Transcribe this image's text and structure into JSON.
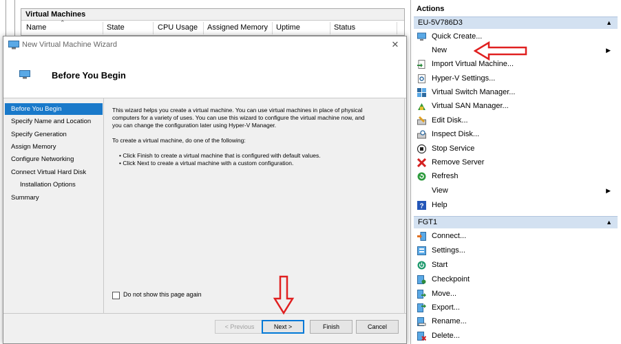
{
  "vm_panel": {
    "title": "Virtual Machines",
    "columns": [
      "Name",
      "State",
      "CPU Usage",
      "Assigned Memory",
      "Uptime",
      "Status"
    ]
  },
  "actions": {
    "title": "Actions",
    "sections": [
      {
        "header": "EU-5V786D3",
        "items": [
          {
            "label": "Quick Create...",
            "icon": "monitor-icon"
          },
          {
            "label": "New",
            "icon": "none",
            "submenu": true
          },
          {
            "label": "Import Virtual Machine...",
            "icon": "import-icon"
          },
          {
            "label": "Hyper-V Settings...",
            "icon": "settings-page-icon"
          },
          {
            "label": "Virtual Switch Manager...",
            "icon": "switch-icon"
          },
          {
            "label": "Virtual SAN Manager...",
            "icon": "san-icon"
          },
          {
            "label": "Edit Disk...",
            "icon": "edit-disk-icon"
          },
          {
            "label": "Inspect Disk...",
            "icon": "inspect-disk-icon"
          },
          {
            "label": "Stop Service",
            "icon": "stop-icon"
          },
          {
            "label": "Remove Server",
            "icon": "remove-x-icon"
          },
          {
            "label": "Refresh",
            "icon": "refresh-icon"
          },
          {
            "label": "View",
            "icon": "none",
            "submenu": true
          },
          {
            "label": "Help",
            "icon": "help-icon"
          }
        ]
      },
      {
        "header": "FGT1",
        "items": [
          {
            "label": "Connect...",
            "icon": "connect-icon"
          },
          {
            "label": "Settings...",
            "icon": "vm-settings-icon"
          },
          {
            "label": "Start",
            "icon": "power-icon"
          },
          {
            "label": "Checkpoint",
            "icon": "checkpoint-icon"
          },
          {
            "label": "Move...",
            "icon": "move-icon"
          },
          {
            "label": "Export...",
            "icon": "export-icon"
          },
          {
            "label": "Rename...",
            "icon": "rename-icon"
          },
          {
            "label": "Delete...",
            "icon": "delete-icon"
          }
        ]
      }
    ]
  },
  "wizard": {
    "title": "New Virtual Machine Wizard",
    "close_glyph": "✕",
    "heading": "Before You Begin",
    "nav": [
      "Before You Begin",
      "Specify Name and Location",
      "Specify Generation",
      "Assign Memory",
      "Configure Networking",
      "Connect Virtual Hard Disk",
      "Installation Options",
      "Summary"
    ],
    "intro_line1": "This wizard helps you create a virtual machine. You can use virtual machines in place of physical",
    "intro_line2": "computers for a variety of uses. You can use this wizard to configure the virtual machine now, and",
    "intro_line3": "you can change the configuration later using Hyper-V Manager.",
    "todo": "To create a virtual machine, do one of the following:",
    "bullet1": "• Click Finish to create a virtual machine that is configured with default values.",
    "bullet2": "• Click Next to create a virtual machine with a custom configuration.",
    "checkbox_label": "Do not show this page again",
    "buttons": {
      "previous": "< Previous",
      "next": "Next >",
      "finish": "Finish",
      "cancel": "Cancel"
    }
  },
  "colors": {
    "accent": "#1979ca",
    "section_header": "#d3e1f1",
    "annotation_red": "#e02020"
  }
}
